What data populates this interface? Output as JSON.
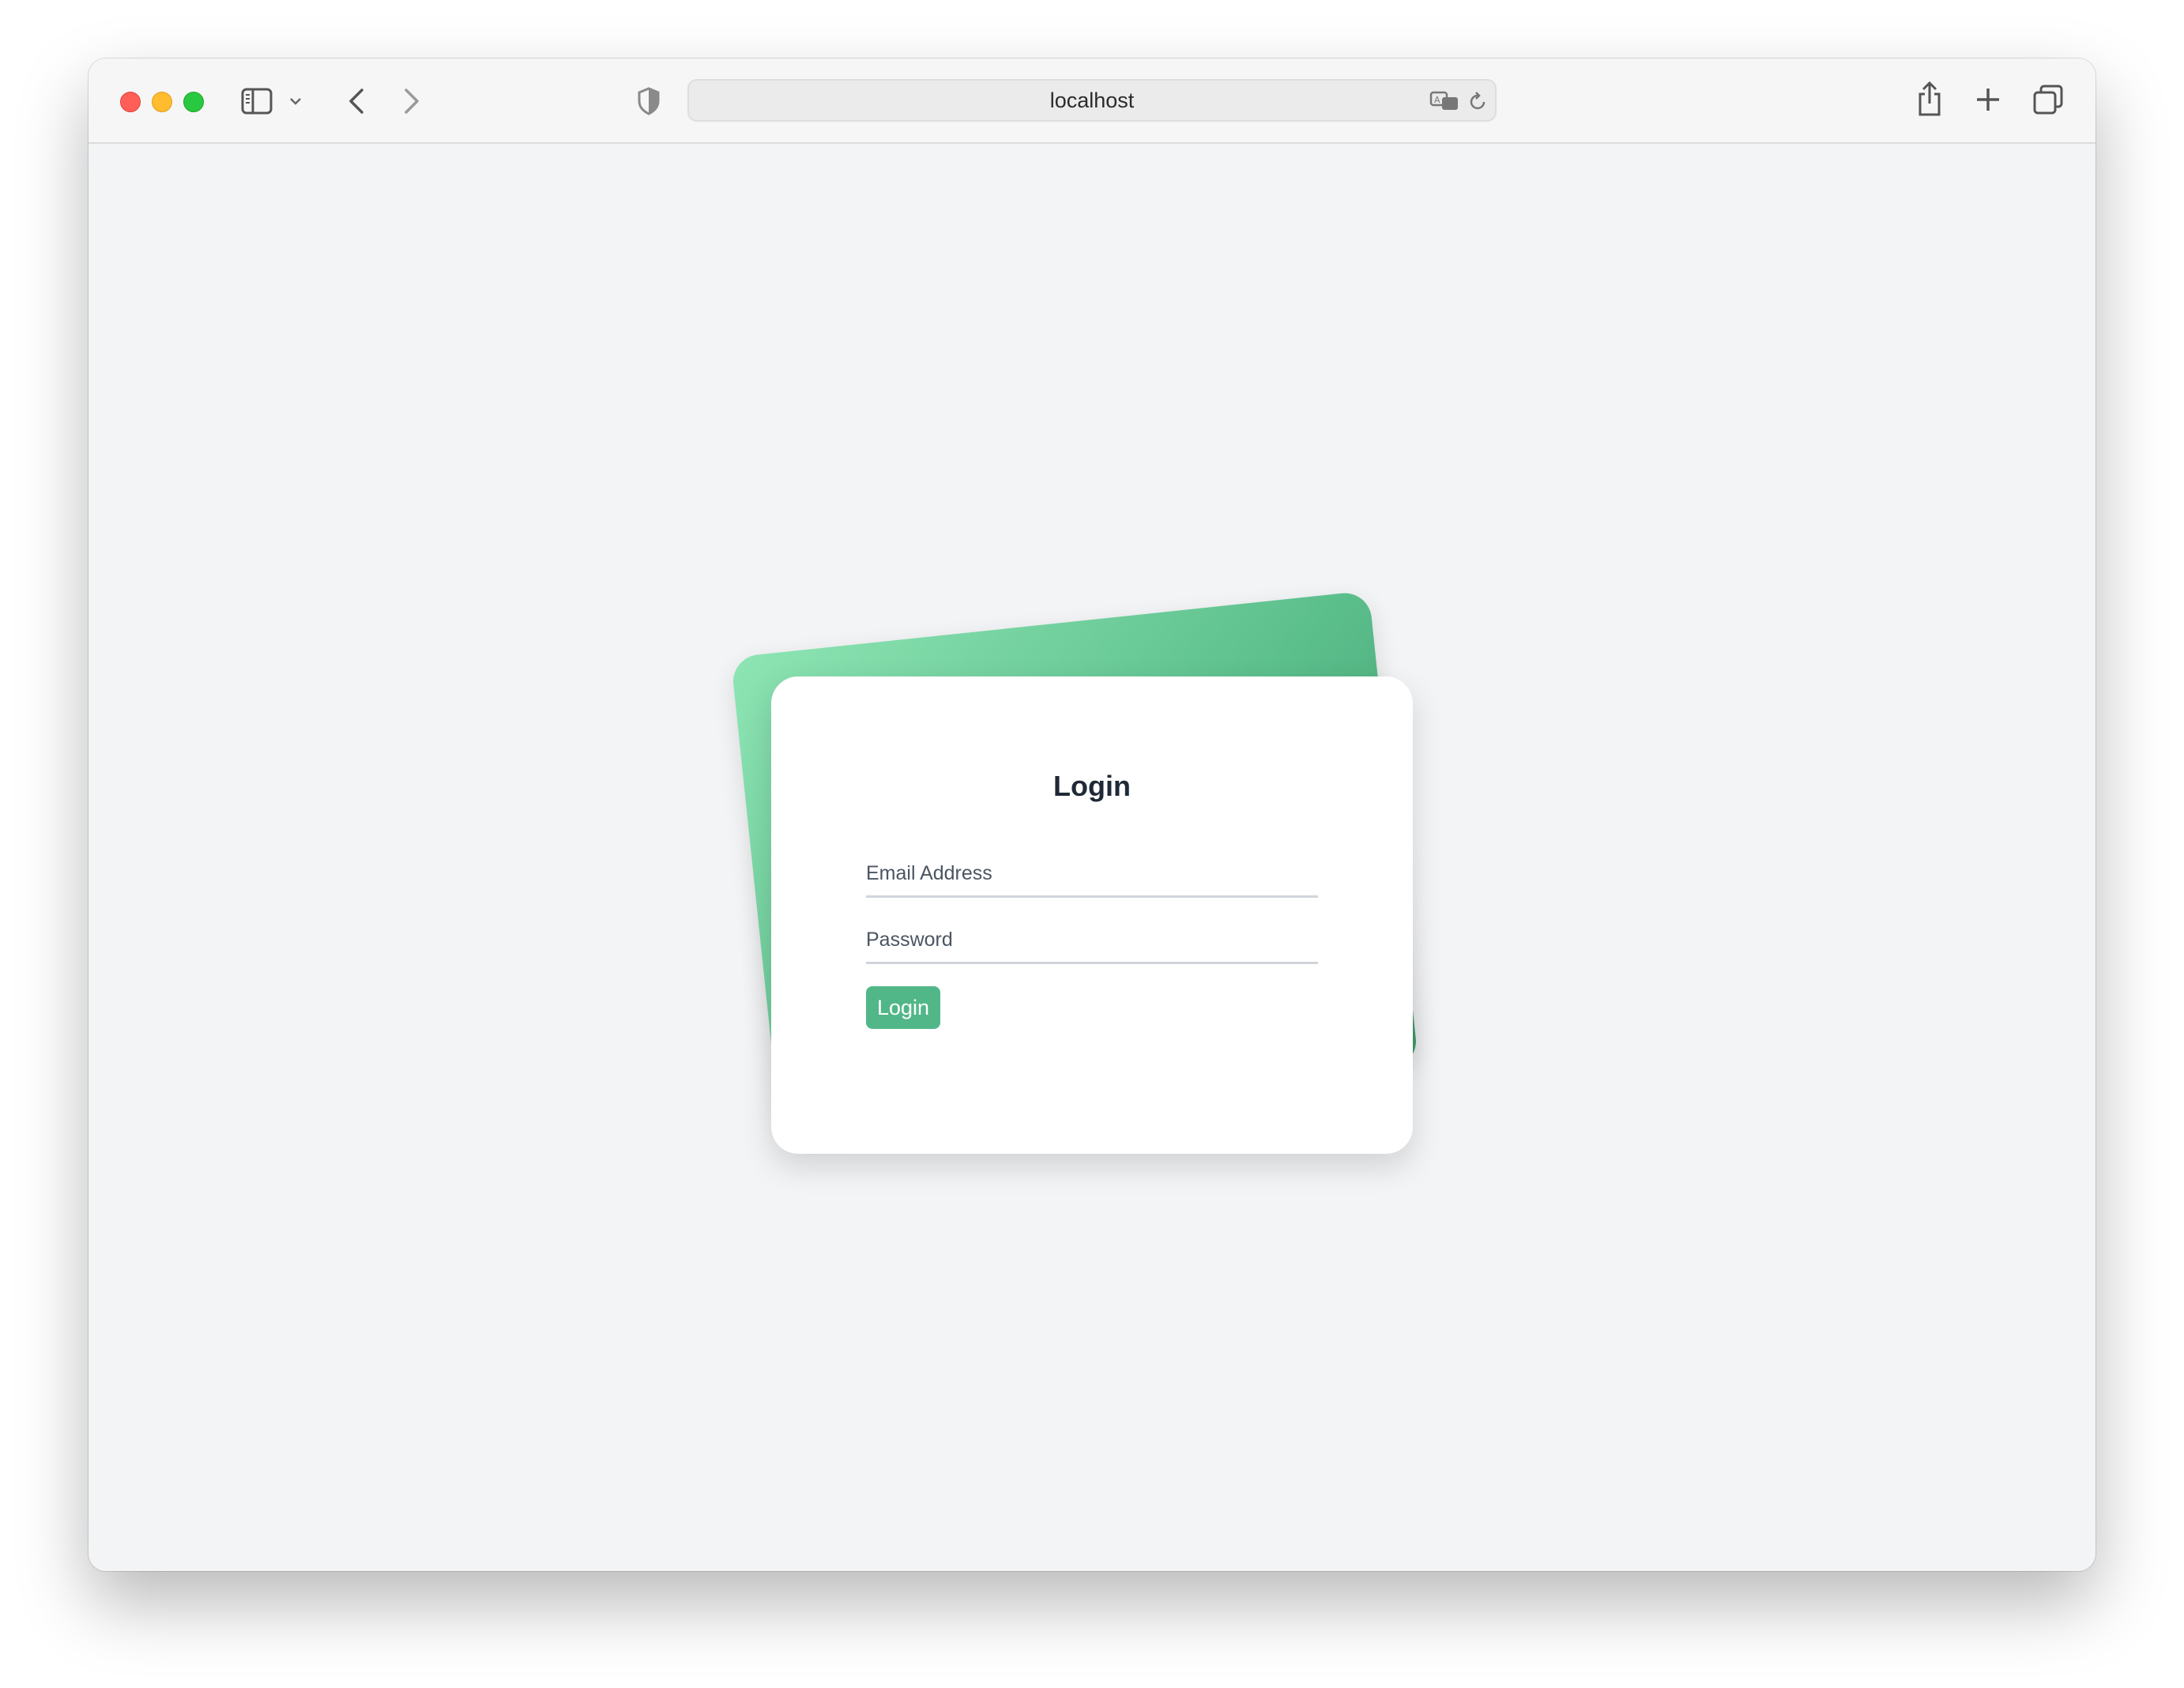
{
  "browser": {
    "address": "localhost",
    "icons": {
      "sidebar": "sidebar-icon",
      "sidebar_menu": "chevron-down-icon",
      "back": "chevron-left-icon",
      "forward": "chevron-right-icon",
      "privacy": "shield-icon",
      "translate": "translate-icon",
      "reload": "reload-icon",
      "share": "share-icon",
      "new_tab": "plus-icon",
      "tab_overview": "tabs-icon"
    }
  },
  "login": {
    "title": "Login",
    "email_placeholder": "Email Address",
    "password_placeholder": "Password",
    "submit_label": "Login"
  },
  "colors": {
    "accent": "#52b788",
    "background": "#f3f4f6",
    "card": "#ffffff",
    "title": "#1f2937"
  }
}
